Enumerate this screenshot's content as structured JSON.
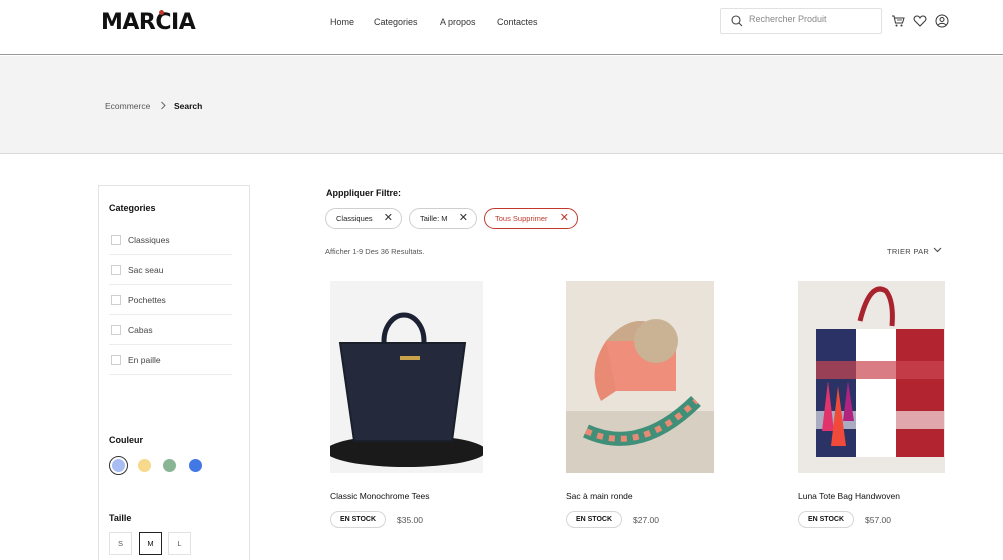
{
  "header": {
    "logo": "MARCIA",
    "nav": [
      "Home",
      "Categories",
      "A propos",
      "Contactes"
    ],
    "search_placeholder": "Rechercher Produit"
  },
  "breadcrumb": {
    "root": "Ecommerce",
    "current": "Search"
  },
  "sidebar": {
    "categories_title": "Categories",
    "categories": [
      "Classiques",
      "Sac seau",
      "Pochettes",
      "Cabas",
      "En paille"
    ],
    "color_title": "Couleur",
    "colors": [
      "#a9bdf2",
      "#f7d98b",
      "#8ab595",
      "#4178e6"
    ],
    "selected_color_index": 0,
    "size_title": "Taille",
    "sizes": [
      "S",
      "M",
      "L"
    ],
    "selected_size": "M"
  },
  "filters": {
    "title": "Apppliquer Filtre:",
    "chips": [
      "Classiques",
      "Taille: M"
    ],
    "clear_all": "Tous Supprimer",
    "results_text": "Afficher 1-9 Des 36 Resultats.",
    "sort_label": "TRIER PAR"
  },
  "products": [
    {
      "name": "Classic Monochrome Tees",
      "stock": "EN STOCK",
      "price": "$35.00"
    },
    {
      "name": "Sac à main ronde",
      "stock": "EN STOCK",
      "price": "$27.00"
    },
    {
      "name": "Luna Tote Bag Handwoven",
      "stock": "EN STOCK",
      "price": "$57.00"
    }
  ],
  "icons": {
    "search": "search-icon",
    "cart": "cart-icon",
    "wishlist": "heart-icon",
    "account": "user-icon",
    "breadcrumb_sep": "chevron-right-icon",
    "remove": "close-icon",
    "sort": "chevron-down-icon"
  }
}
